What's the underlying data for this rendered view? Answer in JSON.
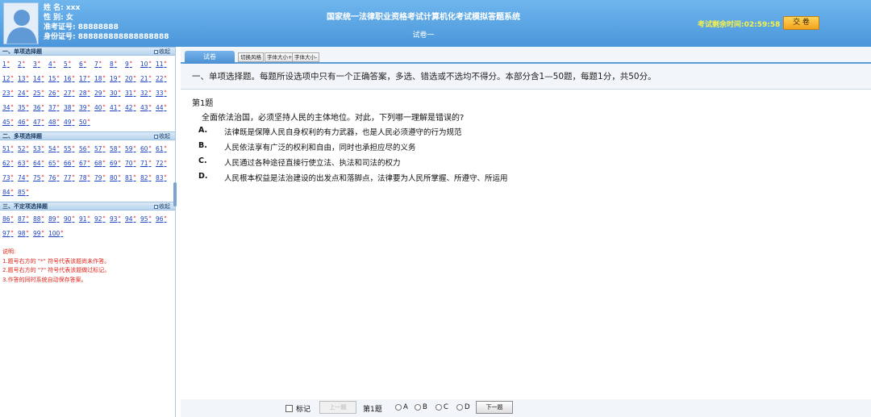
{
  "header": {
    "name_label": "姓 名:",
    "name_value": "xxx",
    "gender_label": "性 别:",
    "gender_value": "女",
    "admission_label": "准考证号:",
    "admission_value": "88888888",
    "id_label": "身份证号:",
    "id_value": "888888888888888888",
    "system_title": "国家统一法律职业资格考试计算机化考试模拟答题系统",
    "paper_name": "试卷一",
    "timer_label": "考试剩余时间:",
    "timer_value": "02:59:58",
    "submit_label": "交 卷"
  },
  "sections": [
    {
      "title": "一、单项选择题",
      "collapse": "收起",
      "start": 1,
      "end": 50
    },
    {
      "title": "二、多项选择题",
      "collapse": "收起",
      "start": 51,
      "end": 85
    },
    {
      "title": "三、不定项选择题",
      "collapse": "收起",
      "start": 86,
      "end": 100
    }
  ],
  "unanswered_mark": "*",
  "notes": [
    "说明:",
    "1.题号右方的 \"*\" 符号代表该题尚未作答。",
    "2.题号右方的 \"?\" 符号代表该题做过标记。",
    "3.作答的同时系统自动保存答案。"
  ],
  "toolbar": {
    "paper_tab": "试卷",
    "switch_style": "切换风格",
    "font_bigger": "字体大小+",
    "font_smaller": "字体大小-"
  },
  "instructions": "一、单项选择题。每题所设选项中只有一个正确答案，多选、错选或不选均不得分。本部分含1—50题，每题1分，共50分。",
  "question": {
    "number_label": "第1题",
    "stem": "全面依法治国，必须坚持人民的主体地位。对此，下列哪一理解是错误的?",
    "options": [
      {
        "letter": "A.",
        "text": "法律既是保障人民自身权利的有力武器，也是人民必须遵守的行为规范"
      },
      {
        "letter": "B.",
        "text": "人民依法享有广泛的权利和自由，同时也承担应尽的义务"
      },
      {
        "letter": "C.",
        "text": "人民通过各种途径直接行使立法、执法和司法的权力"
      },
      {
        "letter": "D.",
        "text": "人民根本权益是法治建设的出发点和落脚点，法律要为人民所掌握、所遵守、所运用"
      }
    ]
  },
  "bottom": {
    "mark_label": "标记",
    "prev_label": "上一题",
    "current_q": "第1题",
    "answers": [
      "A",
      "B",
      "C",
      "D"
    ],
    "next_label": "下一题"
  }
}
